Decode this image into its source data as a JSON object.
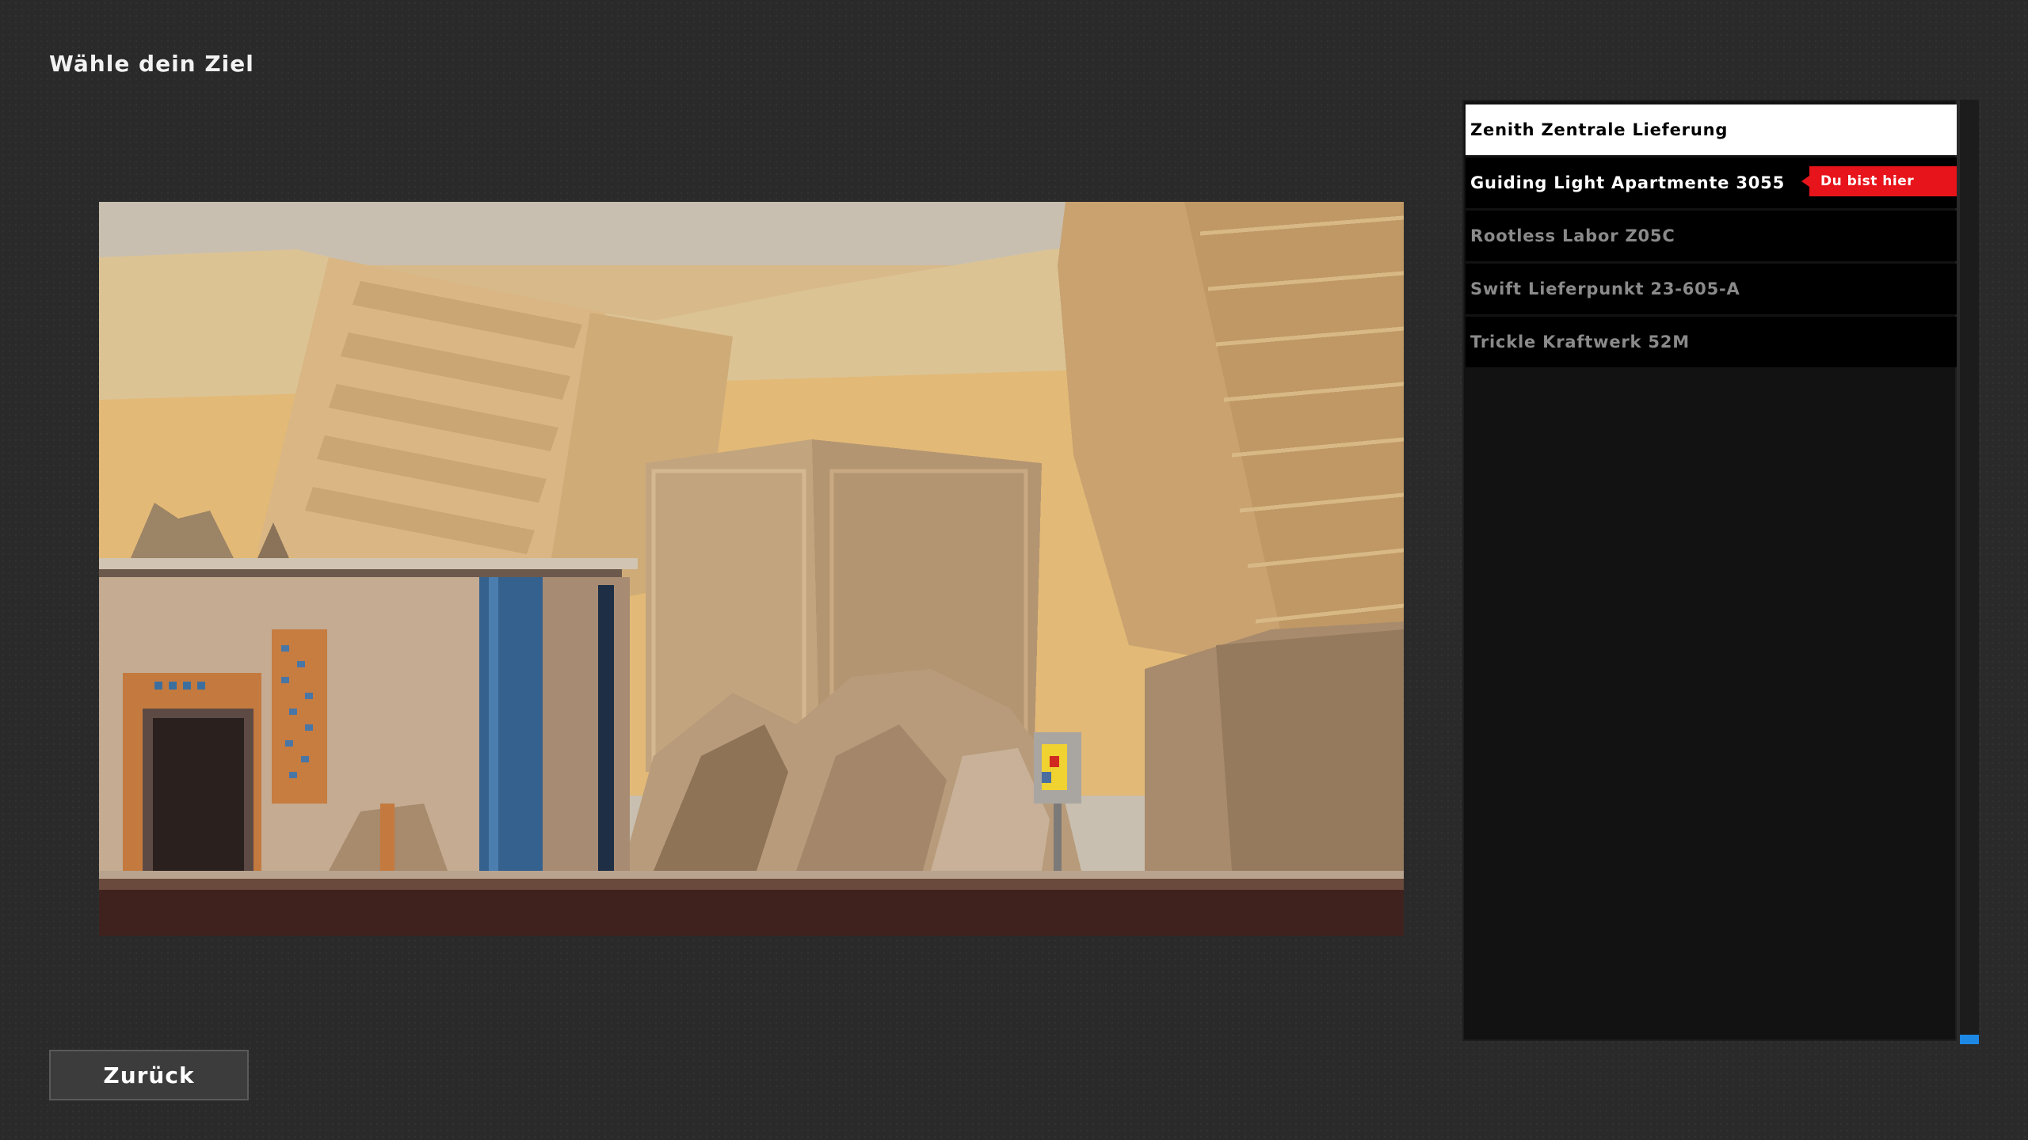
{
  "screen": {
    "title": "Wähle dein Ziel"
  },
  "destinations": [
    {
      "name": "Zenith Zentrale Lieferung",
      "state": "selected"
    },
    {
      "name": "Guiding Light Apartmente 3055",
      "state": "current"
    },
    {
      "name": "Rootless Labor Z05C",
      "state": "normal"
    },
    {
      "name": "Swift Lieferpunkt 23-605-A",
      "state": "normal"
    },
    {
      "name": "Trickle Kraftwerk 52M",
      "state": "normal"
    }
  ],
  "current_location_badge": "Du bist hier",
  "footer": {
    "back_label": "Zurück"
  },
  "colors": {
    "background": "#2a2a2a",
    "badge": "#e8141b",
    "scroll_thumb": "#1e88e5",
    "selected_bg": "#ffffff"
  }
}
